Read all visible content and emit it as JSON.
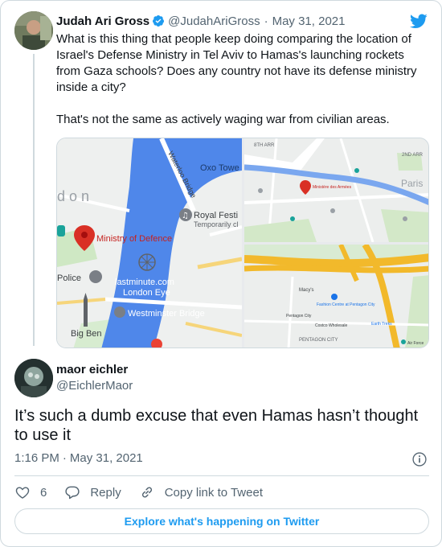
{
  "quoted_tweet": {
    "author_name": "Judah Ari Gross",
    "handle": "@JudahAriGross",
    "separator": "·",
    "date": "May 31, 2021",
    "paragraph_1": "What is this thing that people keep doing comparing the location of Israel's Defense Ministry in Tel Aviv to Hamas's launching rockets from Gaza schools? Does any country not have its defense ministry inside a city?",
    "paragraph_2": "That's not the same as actively waging war from civilian areas.",
    "media": {
      "map_london": {
        "label_oxo": "Oxo Towe",
        "label_waterloo": "Waterloo Bridge",
        "label_don": "d o n",
        "label_royal": "Royal Festi",
        "label_royal_sub": "Temporarily cl",
        "label_ministry": "Ministry of Defence",
        "label_police": "Police",
        "label_lastminute": "lastminute.com",
        "label_london_eye": "London Eye",
        "label_westminster": "Westminster Bridge",
        "label_big_ben": "Big Ben"
      },
      "map_paris": {
        "label_arr": "8TH ARR",
        "label_arr2": "2ND ARR",
        "label_paris": "Paris",
        "label_ministry": "Ministère des Armées"
      },
      "map_pentagon": {
        "label_macys": "Macy's",
        "label_fashion": "Fashion Centre at Pentagon City",
        "label_pentagon_city": "Pentagon City",
        "label_costco": "Costco Wholesale",
        "label_earth_treks": "Earth Treks",
        "label_district": "PENTAGON CITY",
        "label_air_force": "Air Force"
      }
    }
  },
  "reply": {
    "author_name": "maor eichler",
    "handle": "@EichlerMaor",
    "text": "It’s such a dumb excuse that even Hamas hasn’t thought to use it",
    "time": "1:16 PM",
    "separator": "·",
    "date": "May 31, 2021"
  },
  "actions": {
    "like_count": "6",
    "reply_label": "Reply",
    "copy_link_label": "Copy link to Tweet"
  },
  "explore_label": "Explore what's happening on Twitter",
  "colors": {
    "twitter_blue": "#1d9bf0",
    "text_secondary": "#536471",
    "border": "#cfd9de",
    "map_water": "#4f87ea",
    "map_pin": "#d93025"
  }
}
